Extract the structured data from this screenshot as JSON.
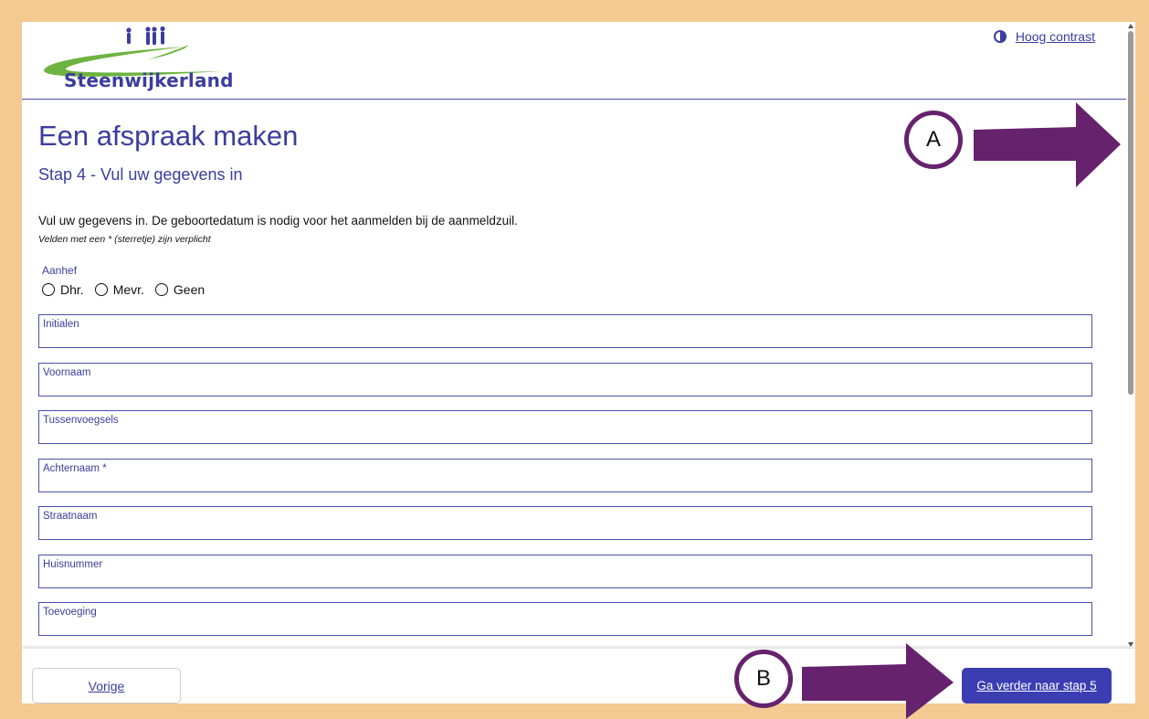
{
  "header": {
    "logo_text": "Steenwijkerland",
    "contrast_link": "Hoog contrast"
  },
  "main": {
    "title": "Een afspraak maken",
    "step": "Stap 4 - Vul uw gegevens in",
    "intro": "Vul uw gegevens in. De geboortedatum is nodig voor het aanmelden bij de aanmeldzuil.",
    "required_note": "Velden met een * (sterretje) zijn verplicht",
    "salutation": {
      "label": "Aanhef",
      "options": [
        "Dhr.",
        "Mevr.",
        "Geen"
      ]
    },
    "fields": [
      "Initialen",
      "Voornaam",
      "Tussenvoegsels",
      "Achternaam *",
      "Straatnaam",
      "Huisnummer",
      "Toevoeging"
    ]
  },
  "footer": {
    "prev_label": "Vorige",
    "next_label": "Ga verder naar stap 5"
  },
  "annotations": {
    "a": "A",
    "b": "B"
  },
  "colors": {
    "brand": "#3b3d9e",
    "button": "#3b3db3",
    "annotation": "#66226d",
    "frame": "#f5c992",
    "logo_green": "#6cb33f"
  }
}
